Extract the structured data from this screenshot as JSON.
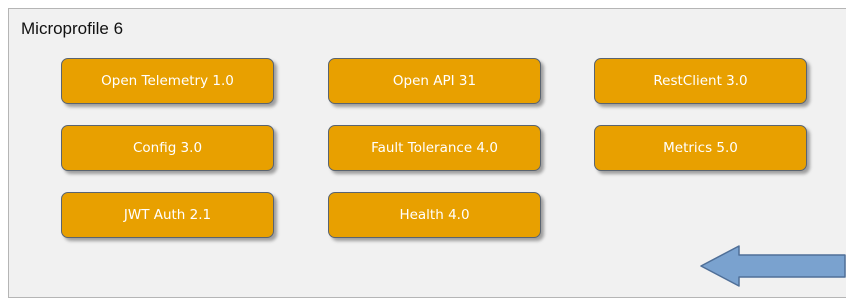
{
  "panel": {
    "title": "Microprofile 6"
  },
  "specs": [
    {
      "label": "Open Telemetry 1.0"
    },
    {
      "label": "Open API 31"
    },
    {
      "label": "RestClient 3.0"
    },
    {
      "label": "Config 3.0"
    },
    {
      "label": "Fault Tolerance 4.0"
    },
    {
      "label": "Metrics 5.0"
    },
    {
      "label": "JWT Auth 2.1"
    },
    {
      "label": "Health 4.0"
    }
  ],
  "colors": {
    "box_fill": "#e8a000",
    "box_text": "#ffffff",
    "arrow_fill": "#7aa2cf",
    "arrow_stroke": "#4f6f98",
    "panel_bg": "#f1f1f1"
  },
  "icons": {
    "arrow": "arrow-left-icon"
  }
}
